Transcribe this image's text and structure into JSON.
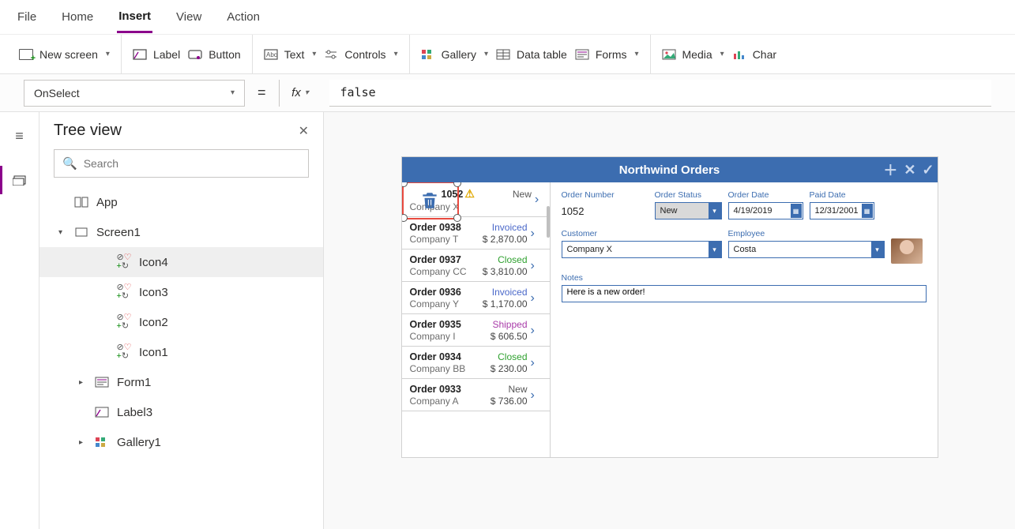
{
  "menubar": {
    "items": [
      "File",
      "Home",
      "Insert",
      "View",
      "Action"
    ],
    "active": "Insert"
  },
  "ribbon": {
    "new_screen": "New screen",
    "label": "Label",
    "button": "Button",
    "text": "Text",
    "controls": "Controls",
    "gallery": "Gallery",
    "datatable": "Data table",
    "forms": "Forms",
    "media": "Media",
    "charts": "Char"
  },
  "formula": {
    "property": "OnSelect",
    "fx": "fx",
    "value": "false"
  },
  "tree": {
    "title": "Tree view",
    "search_placeholder": "Search",
    "items": [
      {
        "label": "App",
        "type": "app",
        "level": 1,
        "expandable": false
      },
      {
        "label": "Screen1",
        "type": "screen",
        "level": 1,
        "expandable": true,
        "expanded": true
      },
      {
        "label": "Icon4",
        "type": "icon-group",
        "level": 3,
        "selected": true
      },
      {
        "label": "Icon3",
        "type": "icon-group",
        "level": 3
      },
      {
        "label": "Icon2",
        "type": "icon-group",
        "level": 3
      },
      {
        "label": "Icon1",
        "type": "icon-group",
        "level": 3
      },
      {
        "label": "Form1",
        "type": "form",
        "level": 2,
        "expandable": true,
        "expanded": false
      },
      {
        "label": "Label3",
        "type": "label",
        "level": 2
      },
      {
        "label": "Gallery1",
        "type": "gallery",
        "level": 2,
        "expandable": true,
        "expanded": false
      }
    ]
  },
  "preview": {
    "title": "Northwind Orders",
    "orders": [
      {
        "orderno": "1052",
        "company": "Company X",
        "status": "New",
        "statusClass": "s-new",
        "amount": "",
        "warn": true,
        "first": true
      },
      {
        "orderno": "Order 0938",
        "company": "Company T",
        "status": "Invoiced",
        "statusClass": "s-invoiced",
        "amount": "$ 2,870.00"
      },
      {
        "orderno": "Order 0937",
        "company": "Company CC",
        "status": "Closed",
        "statusClass": "s-closed",
        "amount": "$ 3,810.00"
      },
      {
        "orderno": "Order 0936",
        "company": "Company Y",
        "status": "Invoiced",
        "statusClass": "s-invoiced",
        "amount": "$ 1,170.00"
      },
      {
        "orderno": "Order 0935",
        "company": "Company I",
        "status": "Shipped",
        "statusClass": "s-shipped",
        "amount": "$ 606.50"
      },
      {
        "orderno": "Order 0934",
        "company": "Company BB",
        "status": "Closed",
        "statusClass": "s-closed",
        "amount": "$ 230.00"
      },
      {
        "orderno": "Order 0933",
        "company": "Company A",
        "status": "New",
        "statusClass": "s-new",
        "amount": "$ 736.00"
      }
    ],
    "form": {
      "order_number_label": "Order Number",
      "order_number": "1052",
      "order_status_label": "Order Status",
      "order_status": "New",
      "order_date_label": "Order Date",
      "order_date": "4/19/2019",
      "paid_date_label": "Paid Date",
      "paid_date": "12/31/2001",
      "customer_label": "Customer",
      "customer": "Company X",
      "employee_label": "Employee",
      "employee": "Costa",
      "notes_label": "Notes",
      "notes": "Here is a new order!"
    }
  }
}
